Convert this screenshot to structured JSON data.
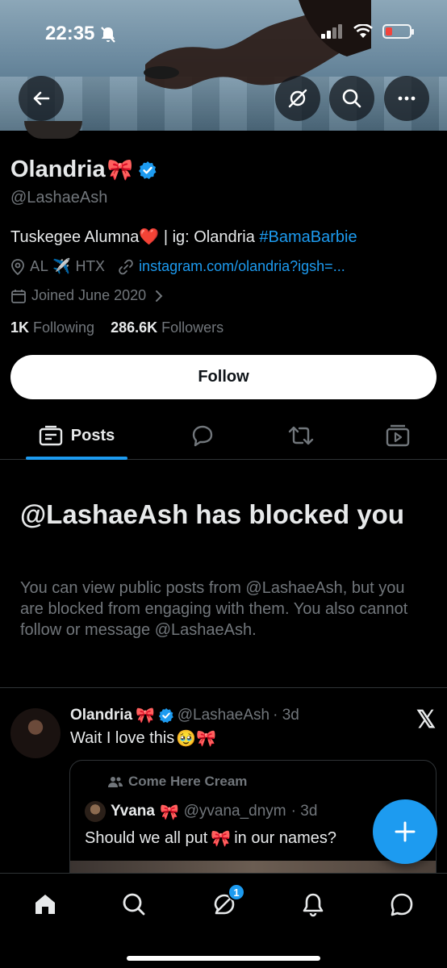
{
  "status_bar": {
    "time": "22:35"
  },
  "profile": {
    "display_name": "Olandria",
    "name_emoji": "🎀",
    "handle": "@LashaeAsh",
    "bio_text": "Tuskegee Alumna",
    "bio_heart": "❤️",
    "bio_rest": " | ig: Olandria ",
    "bio_hashtag": "#BamaBarbie",
    "location": "AL ✈️ HTX",
    "website": "instagram.com/olandria?igsh=...",
    "joined": "Joined June 2020",
    "following_count": "1K",
    "following_label": "Following",
    "followers_count": "286.6K",
    "followers_label": "Followers",
    "follow_button": "Follow"
  },
  "tabs": {
    "posts": "Posts"
  },
  "blocked": {
    "title": "@LashaeAsh has blocked you",
    "text": "You can view public posts from @LashaeAsh, but you are blocked from engaging with them. You also cannot follow or message @LashaeAsh."
  },
  "tweet": {
    "name": "Olandria",
    "name_emoji": "🎀",
    "handle": "@LashaeAsh",
    "time": "· 3d",
    "text": "Wait I love this",
    "text_emojis": "🥹🎀",
    "quote": {
      "community": "Come Here Cream",
      "name": "Yvana",
      "name_emoji": "🎀",
      "handle": "@yvana_dnym",
      "time": "· 3d",
      "text_before": "Should we all put",
      "text_emoji": "🎀",
      "text_after": "in our names?"
    }
  },
  "bottom_nav": {
    "grok_badge": "1"
  },
  "colors": {
    "accent": "#1d9bf0",
    "background": "#000000",
    "text": "#e7e9ea",
    "secondary": "#71767b"
  }
}
